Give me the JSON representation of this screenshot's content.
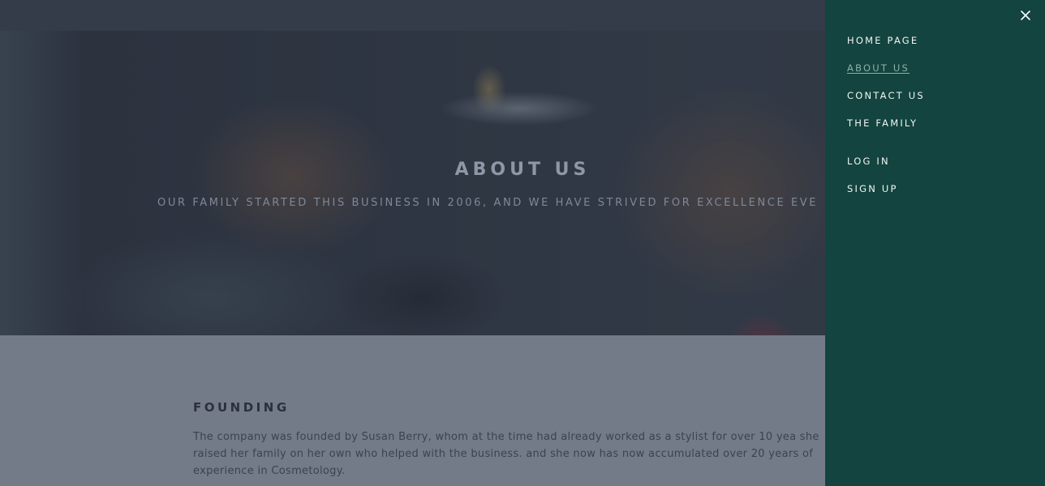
{
  "hero": {
    "title": "ABOUT US",
    "subtitle": "OUR FAMILY STARTED THIS BUSINESS IN 2006, AND WE HAVE STRIVED FOR EXCELLENCE EVE"
  },
  "content": {
    "section_title": "FOUNDING",
    "paragraph": "The company was founded by Susan Berry, whom at the time had already worked as a stylist for over 10 yea she raised her family on her own who helped with the business. and she now has now accumulated over 20 years of experience in Cosmetology."
  },
  "menu": {
    "close_icon": "close-icon",
    "items": [
      {
        "label": "HOME PAGE",
        "active": false
      },
      {
        "label": "ABOUT US",
        "active": true
      },
      {
        "label": "CONTACT US",
        "active": false
      },
      {
        "label": "THE FAMILY",
        "active": false
      },
      {
        "label": "LOG IN",
        "active": false
      },
      {
        "label": "SIGN UP",
        "active": false
      }
    ]
  },
  "colors": {
    "menu_bg": "#13443f",
    "active_link": "#8fb0aa",
    "topbar": "#343c49"
  }
}
